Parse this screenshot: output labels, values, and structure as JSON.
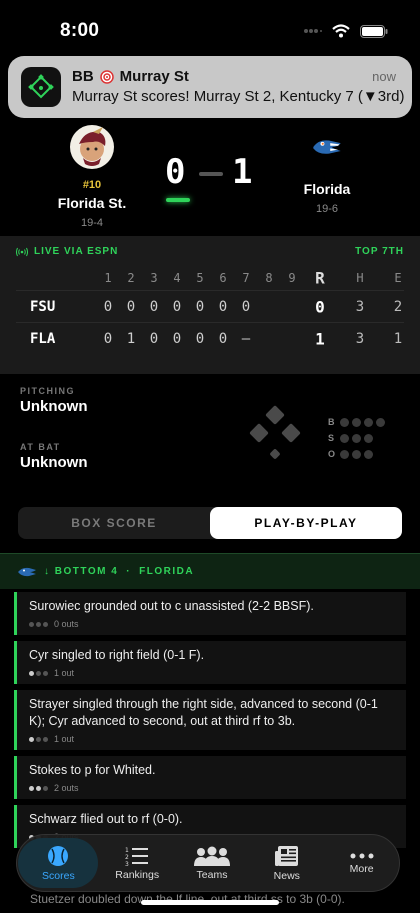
{
  "status_bar": {
    "time": "8:00"
  },
  "notification": {
    "app": "BB",
    "subject": "Murray St",
    "time": "now",
    "body": "Murray St scores! Murray St 2, Kentucky 7 (▼3rd)"
  },
  "game": {
    "away": {
      "rank": "#10",
      "name": "Florida St.",
      "record": "19-4",
      "score": "0",
      "abbr": "FSU"
    },
    "home": {
      "name": "Florida",
      "record": "19-6",
      "score": "1",
      "abbr": "FLA"
    }
  },
  "linescore": {
    "live_label": "LIVE VIA ESPN",
    "inning_label": "TOP 7TH",
    "headers": [
      "1",
      "2",
      "3",
      "4",
      "5",
      "6",
      "7",
      "8",
      "9"
    ],
    "r_label": "R",
    "h_label": "H",
    "e_label": "E",
    "rows": [
      {
        "team": "FSU",
        "innings": [
          "0",
          "0",
          "0",
          "0",
          "0",
          "0",
          "0",
          "",
          ""
        ],
        "r": "0",
        "h": "3",
        "e": "2"
      },
      {
        "team": "FLA",
        "innings": [
          "0",
          "1",
          "0",
          "0",
          "0",
          "0",
          "–",
          "",
          ""
        ],
        "r": "1",
        "h": "3",
        "e": "1"
      }
    ]
  },
  "situation": {
    "pitching_label": "PITCHING",
    "pitcher": "Unknown",
    "at_bat_label": "AT BAT",
    "batter": "Unknown",
    "count_labels": [
      "B",
      "S",
      "O"
    ]
  },
  "segment": {
    "box_score": "BOX SCORE",
    "play_by_play": "PLAY-BY-PLAY"
  },
  "half_inning": {
    "label": "↓ BOTTOM 4",
    "separator": "·",
    "team": "FLORIDA"
  },
  "plays": [
    {
      "text": "Surowiec grounded out to c unassisted (2-2 BBSF).",
      "outs": "0 outs",
      "outs_count": 0
    },
    {
      "text": "Cyr singled to right field (0-1 F).",
      "outs": "1 out",
      "outs_count": 1
    },
    {
      "text": "Strayer singled through the right side, advanced to second (0-1 K); Cyr advanced to second, out at third rf to 3b.",
      "outs": "1 out",
      "outs_count": 1
    },
    {
      "text": "Stokes to p for Whited.",
      "outs": "2 outs",
      "outs_count": 2
    },
    {
      "text": "Schwarz flied out to rf (0-0).",
      "outs": "2 outs",
      "outs_count": 2
    }
  ],
  "peek_text": "Stuetzer doubled down the lf line, out at third ss to 3b (0-0).",
  "tabs": [
    {
      "label": "Scores",
      "icon": "baseball-icon"
    },
    {
      "label": "Rankings",
      "icon": "ranked-list-icon"
    },
    {
      "label": "Teams",
      "icon": "people-icon"
    },
    {
      "label": "News",
      "icon": "newspaper-icon"
    },
    {
      "label": "More",
      "icon": "ellipsis-icon"
    }
  ],
  "colors": {
    "accent_green": "#2fd35a",
    "active_tab": "#3aa8ff",
    "rank_gold": "#e8c43a"
  }
}
